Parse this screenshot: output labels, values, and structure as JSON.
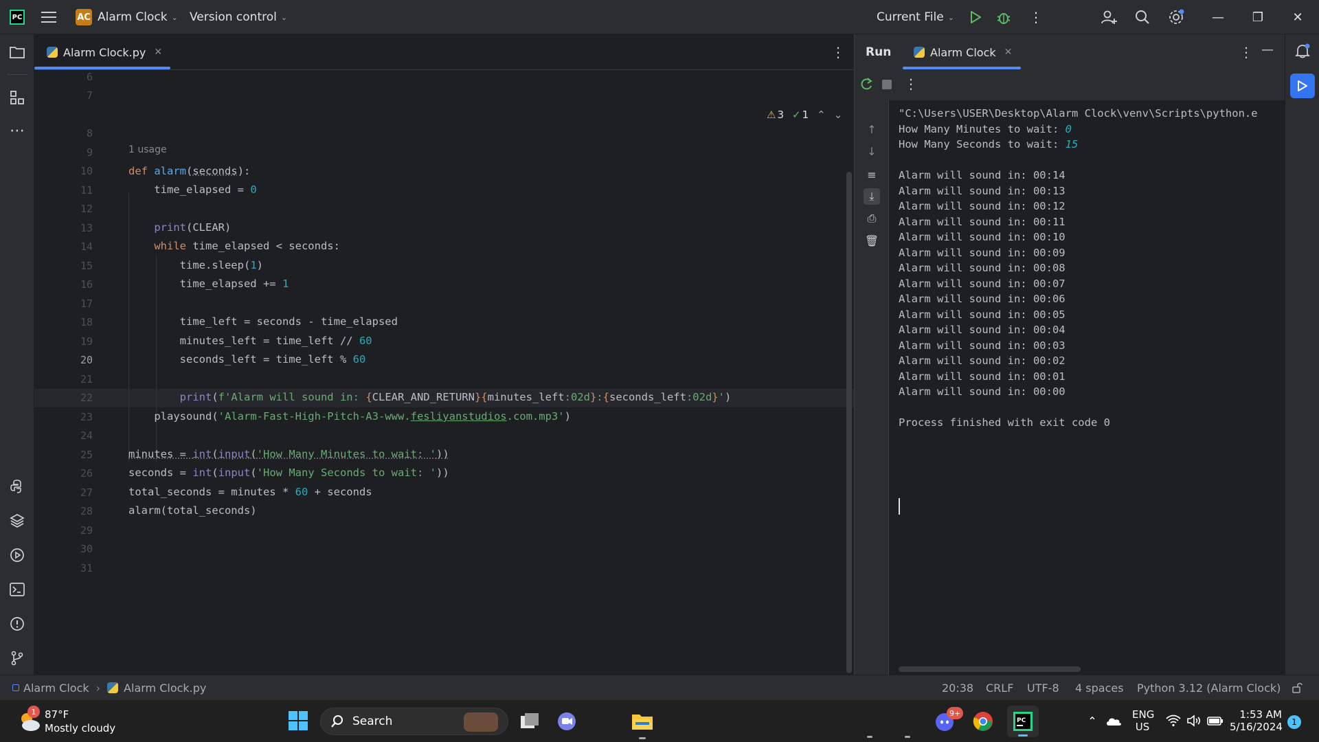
{
  "titlebar": {
    "project_badge": "AC",
    "project_name": "Alarm Clock",
    "vcs": "Version control",
    "run_config": "Current File"
  },
  "editor": {
    "tab_label": "Alarm Clock.py",
    "warnings": "3",
    "checks": "1",
    "usage_hint": "1 usage",
    "line_numbers": [
      "6",
      "7",
      "8",
      "9",
      "10",
      "11",
      "12",
      "13",
      "14",
      "15",
      "16",
      "17",
      "18",
      "19",
      "20",
      "21",
      "22",
      "23",
      "24",
      "25",
      "26",
      "27",
      "28",
      "29",
      "30",
      "31"
    ],
    "active_line": "20"
  },
  "run": {
    "title": "Run",
    "tab_label": "Alarm Clock",
    "console": [
      "\"C:\\Users\\USER\\Desktop\\Alarm Clock\\venv\\Scripts\\python.e",
      "How Many Minutes to wait: ",
      "How Many Seconds to wait: ",
      "",
      "Alarm will sound in: 00:14",
      "Alarm will sound in: 00:13",
      "Alarm will sound in: 00:12",
      "Alarm will sound in: 00:11",
      "Alarm will sound in: 00:10",
      "Alarm will sound in: 00:09",
      "Alarm will sound in: 00:08",
      "Alarm will sound in: 00:07",
      "Alarm will sound in: 00:06",
      "Alarm will sound in: 00:05",
      "Alarm will sound in: 00:04",
      "Alarm will sound in: 00:03",
      "Alarm will sound in: 00:02",
      "Alarm will sound in: 00:01",
      "Alarm will sound in: 00:00",
      "",
      "Process finished with exit code 0"
    ],
    "input_minutes": "0",
    "input_seconds": "15"
  },
  "statusbar": {
    "crumb_project": "Alarm Clock",
    "crumb_file": "Alarm Clock.py",
    "position": "20:38",
    "line_sep": "CRLF",
    "encoding": "UTF-8",
    "indent": "4 spaces",
    "interpreter": "Python 3.12 (Alarm Clock)"
  },
  "taskbar": {
    "weather_temp": "87°F",
    "weather_desc": "Mostly cloudy",
    "weather_badge": "1",
    "search": "Search",
    "discord_badge": "9+",
    "lang": "ENG",
    "region": "US",
    "time": "1:53 AM",
    "date": "5/16/2024",
    "notif_count": "1"
  },
  "colors": {
    "accent": "#548af7",
    "keyword": "#cf8e6d",
    "function": "#56a8f5",
    "number": "#2aacb8",
    "string": "#6aab73"
  }
}
